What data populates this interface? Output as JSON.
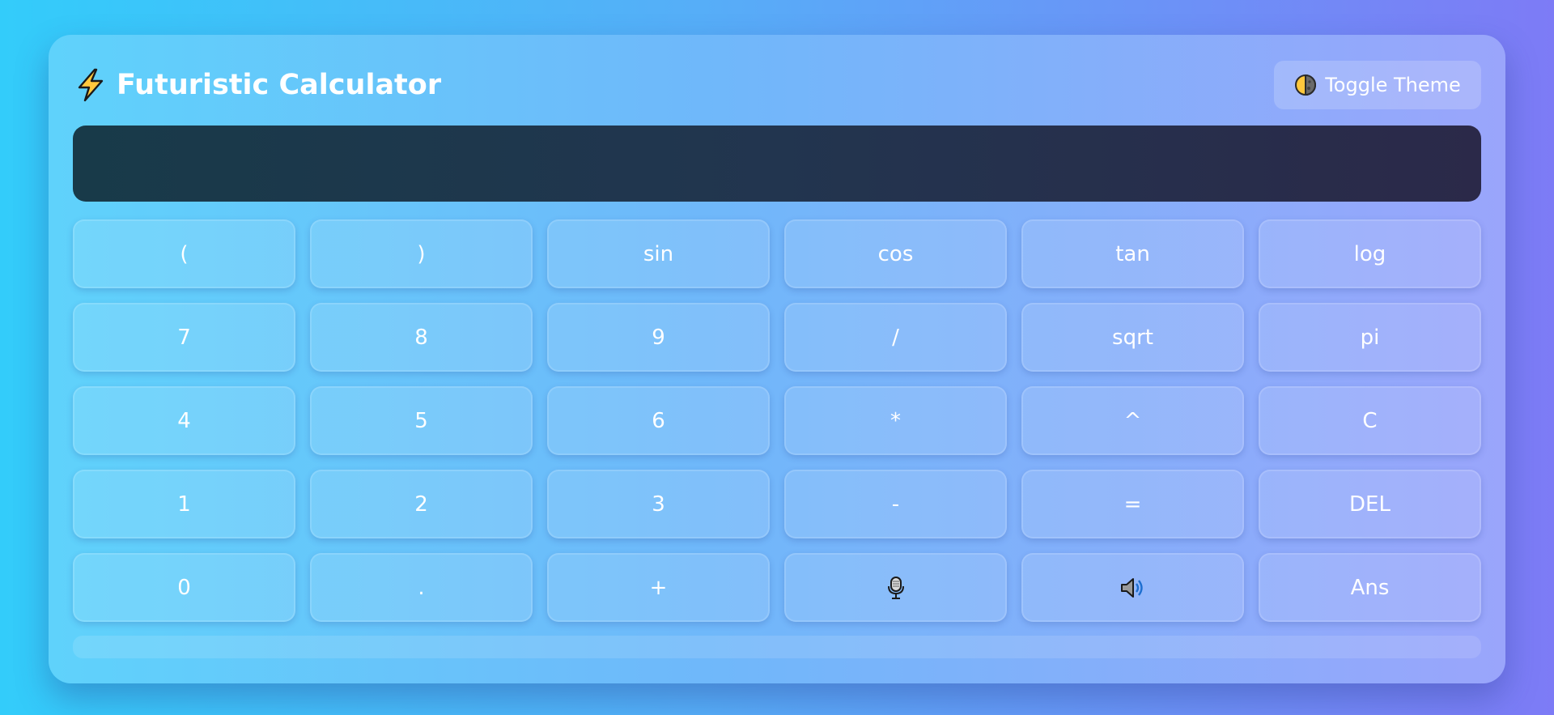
{
  "app": {
    "title": "Futuristic Calculator",
    "title_icon": "lightning-bolt-icon"
  },
  "header": {
    "theme_button_label": "Toggle Theme",
    "theme_button_icon": "half-moon-icon"
  },
  "display": {
    "value": ""
  },
  "keypad": {
    "rows": [
      [
        {
          "label": "(",
          "name": "open-paren-key"
        },
        {
          "label": ")",
          "name": "close-paren-key"
        },
        {
          "label": "sin",
          "name": "sin-key"
        },
        {
          "label": "cos",
          "name": "cos-key"
        },
        {
          "label": "tan",
          "name": "tan-key"
        },
        {
          "label": "log",
          "name": "log-key"
        }
      ],
      [
        {
          "label": "7",
          "name": "digit-7-key"
        },
        {
          "label": "8",
          "name": "digit-8-key"
        },
        {
          "label": "9",
          "name": "digit-9-key"
        },
        {
          "label": "/",
          "name": "divide-key"
        },
        {
          "label": "sqrt",
          "name": "sqrt-key"
        },
        {
          "label": "pi",
          "name": "pi-key"
        }
      ],
      [
        {
          "label": "4",
          "name": "digit-4-key"
        },
        {
          "label": "5",
          "name": "digit-5-key"
        },
        {
          "label": "6",
          "name": "digit-6-key"
        },
        {
          "label": "*",
          "name": "multiply-key"
        },
        {
          "label": "^",
          "name": "power-key"
        },
        {
          "label": "C",
          "name": "clear-key"
        }
      ],
      [
        {
          "label": "1",
          "name": "digit-1-key"
        },
        {
          "label": "2",
          "name": "digit-2-key"
        },
        {
          "label": "3",
          "name": "digit-3-key"
        },
        {
          "label": "-",
          "name": "subtract-key"
        },
        {
          "label": "=",
          "name": "equals-key"
        },
        {
          "label": "DEL",
          "name": "delete-key"
        }
      ],
      [
        {
          "label": "0",
          "name": "digit-0-key"
        },
        {
          "label": ".",
          "name": "decimal-key"
        },
        {
          "label": "+",
          "name": "add-key"
        },
        {
          "label": "",
          "name": "voice-input-key",
          "icon": "microphone-icon"
        },
        {
          "label": "",
          "name": "speak-result-key",
          "icon": "speaker-icon"
        },
        {
          "label": "Ans",
          "name": "answer-key"
        }
      ]
    ]
  },
  "colors": {
    "background_start": "#33ccfa",
    "background_end": "#7d7bf6",
    "display_bg": "#1f3347",
    "key_text": "#ffffff",
    "bolt_yellow": "#ffc83d"
  }
}
